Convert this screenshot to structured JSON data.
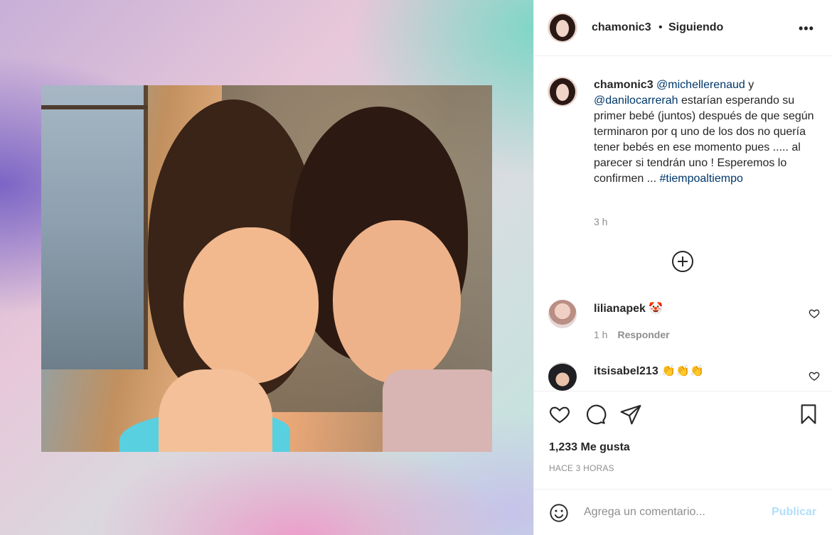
{
  "post": {
    "username": "chamonic3",
    "separator": "•",
    "follow_status": "Siguiendo",
    "more_icon": "more-options-icon"
  },
  "caption": {
    "username": "chamonic3",
    "mention1": "@michellerenaud",
    "text1": " y ",
    "mention2": "@danilocarrerah",
    "text2": " estarían esperando su primer bebé (juntos) después de que según terminaron por q uno de los dos no quería tener bebés en ese momento pues ..... al parecer si tendrán uno ! Esperemos lo confirmen ... ",
    "hashtag": "#tiempoaltiempo",
    "time": "3 h"
  },
  "comments": [
    {
      "username": "lilianapek",
      "emoji": "🤡",
      "time": "1 h",
      "reply_label": "Responder"
    },
    {
      "username": "itsisabel213",
      "emoji": "👏👏👏"
    }
  ],
  "actions": {
    "like_icon": "heart-icon",
    "comment_icon": "comment-icon",
    "share_icon": "send-icon",
    "save_icon": "bookmark-icon"
  },
  "likes": "1,233 Me gusta",
  "posted_ago": "HACE 3 HORAS",
  "add_comment": {
    "placeholder": "Agrega un comentario...",
    "publish_label": "Publicar"
  },
  "colors": {
    "link": "#00376b",
    "muted": "#8e8e8e",
    "publish_disabled": "#b2dffc",
    "text": "#262626"
  }
}
